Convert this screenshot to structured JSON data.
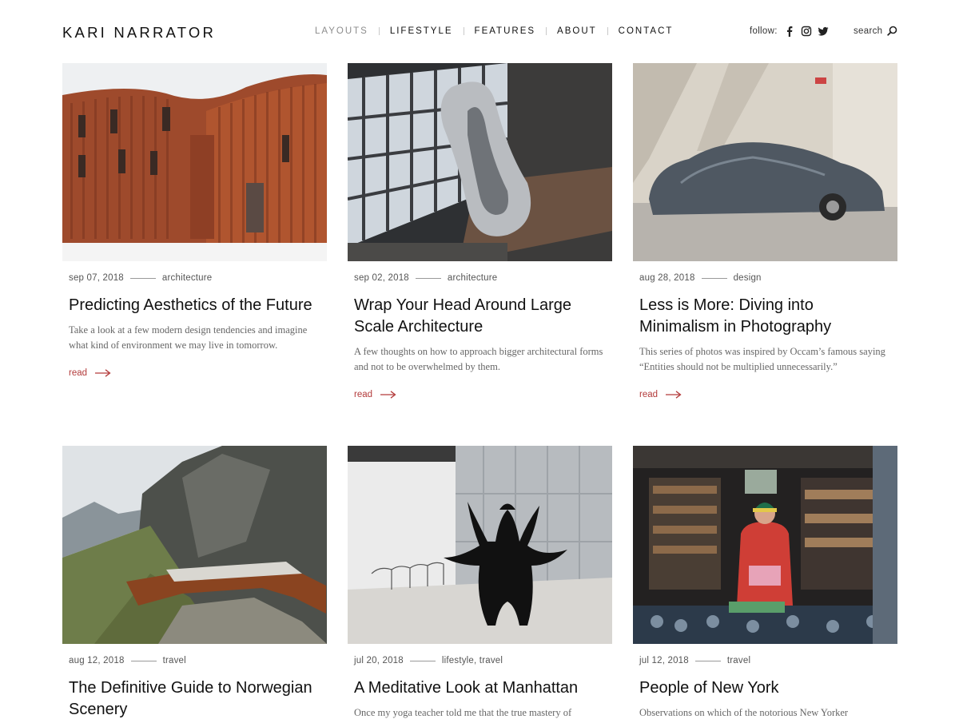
{
  "site": {
    "logo": "KARI NARRATOR",
    "nav": [
      {
        "label": "LAYOUTS",
        "active": true
      },
      {
        "label": "LIFESTYLE"
      },
      {
        "label": "FEATURES"
      },
      {
        "label": "ABOUT"
      },
      {
        "label": "CONTACT"
      }
    ],
    "follow_label": "follow:",
    "social_icons": [
      "facebook-icon",
      "instagram-icon",
      "twitter-icon"
    ],
    "search_label": "search"
  },
  "colors": {
    "accent": "#b33b3b",
    "text": "#111111",
    "muted": "#8c8c8c"
  },
  "posts": [
    {
      "date": "sep 07, 2018",
      "category": "architecture",
      "title": "Predicting Aesthetics of the Future",
      "excerpt": "Take a look at a few modern design tendencies and imagine what kind of environment we may live in tomorrow.",
      "read": "read",
      "image": "red-wooden-building"
    },
    {
      "date": "sep 02, 2018",
      "category": "architecture",
      "title": "Wrap Your Head Around Large Scale Architecture",
      "excerpt": "A few thoughts on how to approach bigger architectural forms and not to be overwhelmed by them.",
      "read": "read",
      "image": "twisted-metal-sculpture"
    },
    {
      "date": "aug 28, 2018",
      "category": "design",
      "title": "Less is More: Diving into Minimalism in Photography",
      "excerpt": "This series of photos was inspired by Occam’s famous saying “Entities should not be multiplied unnecessarily.”",
      "read": "read",
      "image": "covered-car"
    },
    {
      "date": "aug 12, 2018",
      "category": "travel",
      "title": "The Definitive Guide to Norwegian Scenery",
      "excerpt": "",
      "read": "",
      "image": "mountain-viewpoint"
    },
    {
      "date": "jul 20, 2018",
      "category": "lifestyle, travel",
      "title": "A Meditative Look at Manhattan",
      "excerpt": "Once my yoga teacher told me that the true mastery of",
      "read": "",
      "image": "black-sculpture"
    },
    {
      "date": "jul 12, 2018",
      "category": "travel",
      "title": "People of New York",
      "excerpt": "Observations on which of the notorious New Yorker",
      "read": "",
      "image": "bookshop-reader"
    }
  ]
}
